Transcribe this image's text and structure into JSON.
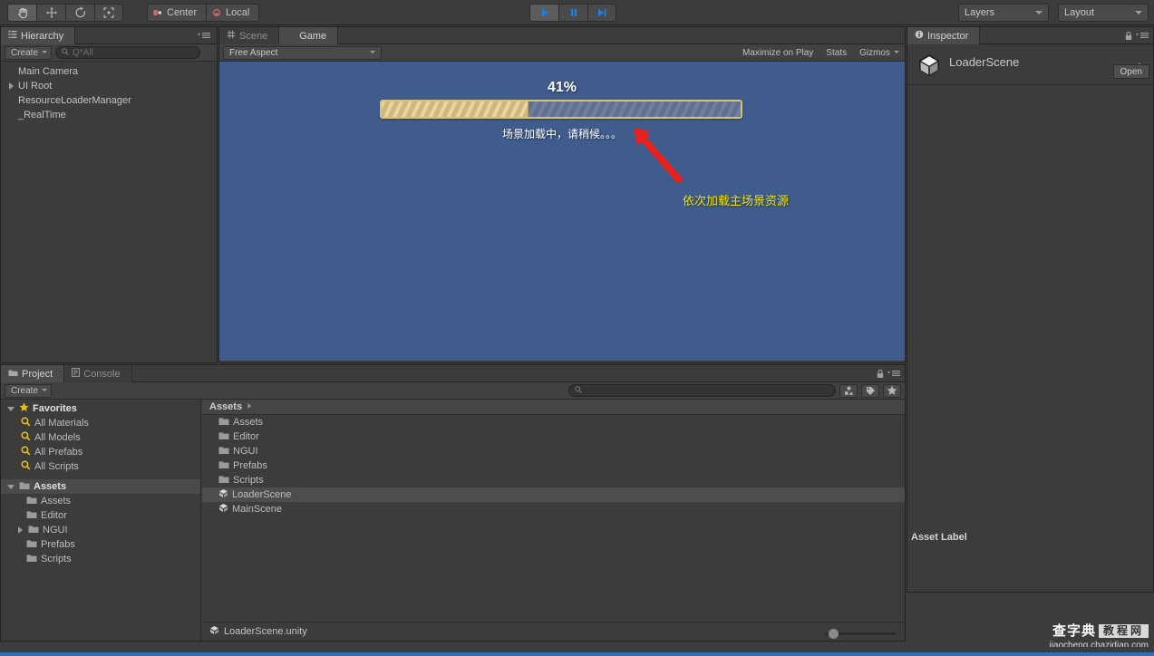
{
  "toolbar": {
    "transform_tools": [
      {
        "name": "hand-tool",
        "icon": "hand",
        "active": true
      },
      {
        "name": "move-tool",
        "icon": "move",
        "active": false
      },
      {
        "name": "rotate-tool",
        "icon": "rotate",
        "active": false
      },
      {
        "name": "scale-tool",
        "icon": "scale",
        "active": false
      }
    ],
    "pivot_label": "Center",
    "space_label": "Local",
    "play_label": "play",
    "pause_label": "pause",
    "step_label": "step",
    "layers_label": "Layers",
    "layout_label": "Layout"
  },
  "hierarchy": {
    "tab_label": "Hierarchy",
    "create_label": "Create",
    "search_placeholder": "Q*All",
    "items": [
      {
        "label": "Main Camera",
        "expandable": false
      },
      {
        "label": "UI Root",
        "expandable": true
      },
      {
        "label": "ResourceLoaderManager",
        "expandable": false
      },
      {
        "label": "_RealTime",
        "expandable": false
      }
    ]
  },
  "gameview": {
    "tabs": [
      {
        "label": "Scene",
        "icon": "grid-icon",
        "active": false
      },
      {
        "label": "Game",
        "icon": "game-icon",
        "active": true
      }
    ],
    "aspect_label": "Free Aspect",
    "maximize_label": "Maximize on Play",
    "stats_label": "Stats",
    "gizmos_label": "Gizmos",
    "percent_label": "41%",
    "progress_value": 41,
    "loading_text": "场景加载中，请稍候。。。",
    "annotation_text": "依次加载主场景资源",
    "background_color": "#3f5c8c",
    "progress_fill_color": "#e8d5a0",
    "progress_border_color": "#d9c27f",
    "annotation_color": "#f2e400",
    "arrow_color": "#e8211d"
  },
  "inspector": {
    "tab_label": "Inspector",
    "asset_name": "LoaderScene",
    "open_label": "Open",
    "asset_label_label": "Asset Label"
  },
  "project": {
    "tabs": [
      {
        "label": "Project",
        "icon": "folder-icon",
        "active": true
      },
      {
        "label": "Console",
        "icon": "console-icon",
        "active": false
      }
    ],
    "create_label": "Create",
    "search_placeholder": "",
    "favorites_label": "Favorites",
    "favorites": [
      {
        "label": "All Materials"
      },
      {
        "label": "All Models"
      },
      {
        "label": "All Prefabs"
      },
      {
        "label": "All Scripts"
      }
    ],
    "assets_root_label": "Assets",
    "assets_tree": [
      {
        "label": "Assets",
        "expandable": false
      },
      {
        "label": "Editor",
        "expandable": false
      },
      {
        "label": "NGUI",
        "expandable": true
      },
      {
        "label": "Prefabs",
        "expandable": false
      },
      {
        "label": "Scripts",
        "expandable": false
      }
    ],
    "breadcrumb_label": "Assets",
    "content_items": [
      {
        "label": "Assets",
        "type": "folder",
        "selected": false
      },
      {
        "label": "Editor",
        "type": "folder",
        "selected": false
      },
      {
        "label": "NGUI",
        "type": "folder",
        "selected": false
      },
      {
        "label": "Prefabs",
        "type": "folder",
        "selected": false
      },
      {
        "label": "Scripts",
        "type": "folder",
        "selected": false
      },
      {
        "label": "LoaderScene",
        "type": "scene",
        "selected": true
      },
      {
        "label": "MainScene",
        "type": "scene",
        "selected": false
      }
    ],
    "status_label": "LoaderScene.unity"
  },
  "watermark": {
    "cn_text": "查字典",
    "box_text": "教程网",
    "url_text": "jiaocheng.chazidian.com"
  }
}
